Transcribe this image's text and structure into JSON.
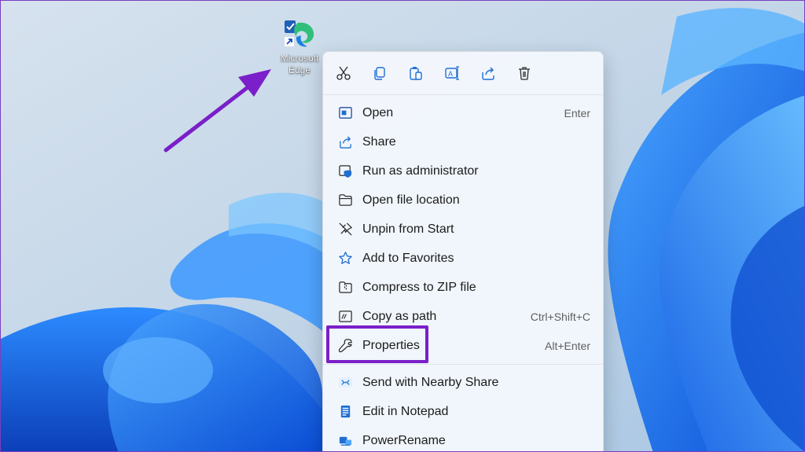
{
  "desktop": {
    "icon": {
      "label_line1": "Microsoft",
      "label_line2": "Edge",
      "icon_name": "microsoft-edge-shortcut-icon"
    }
  },
  "context_menu": {
    "toolbar": [
      {
        "name": "cut-icon",
        "tooltip": "Cut"
      },
      {
        "name": "copy-icon",
        "tooltip": "Copy"
      },
      {
        "name": "paste-icon",
        "tooltip": "Paste"
      },
      {
        "name": "rename-icon",
        "tooltip": "Rename"
      },
      {
        "name": "share-icon",
        "tooltip": "Share"
      },
      {
        "name": "delete-icon",
        "tooltip": "Delete"
      }
    ],
    "items": [
      {
        "label": "Open",
        "shortcut": "Enter",
        "icon": "open-window-icon"
      },
      {
        "label": "Share",
        "shortcut": "",
        "icon": "share-icon"
      },
      {
        "label": "Run as administrator",
        "shortcut": "",
        "icon": "shield-window-icon"
      },
      {
        "label": "Open file location",
        "shortcut": "",
        "icon": "folder-icon"
      },
      {
        "label": "Unpin from Start",
        "shortcut": "",
        "icon": "unpin-icon"
      },
      {
        "label": "Add to Favorites",
        "shortcut": "",
        "icon": "star-icon"
      },
      {
        "label": "Compress to ZIP file",
        "shortcut": "",
        "icon": "zip-folder-icon"
      },
      {
        "label": "Copy as path",
        "shortcut": "Ctrl+Shift+C",
        "icon": "path-icon"
      },
      {
        "label": "Properties",
        "shortcut": "Alt+Enter",
        "icon": "wrench-icon"
      }
    ],
    "extra_items": [
      {
        "label": "Send with Nearby Share",
        "icon": "nearby-share-icon"
      },
      {
        "label": "Edit in Notepad",
        "icon": "notepad-icon"
      },
      {
        "label": "PowerRename",
        "icon": "powerrename-icon"
      }
    ]
  },
  "colors": {
    "accent_purple": "#7a1fc9",
    "icon_blue": "#1f6fd1",
    "menu_bg": "#f3f7fc"
  }
}
